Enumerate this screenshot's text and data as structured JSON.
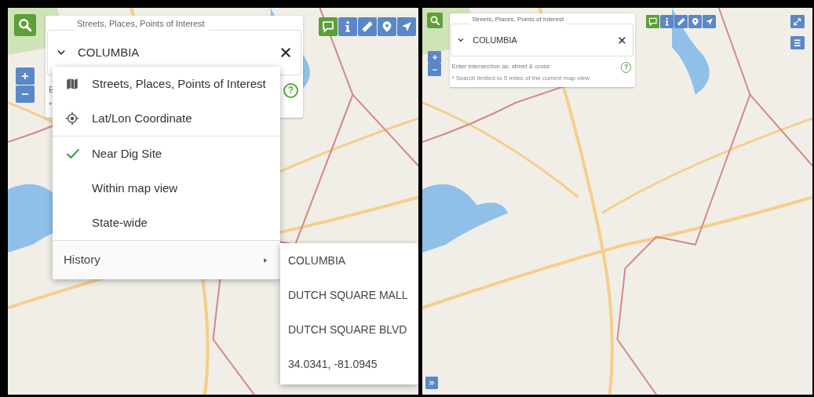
{
  "panels": [
    {
      "search": {
        "legend": "Streets, Places, Points of Interest",
        "value": "COLUMBIA",
        "hint": "E",
        "note": "*",
        "help": "?"
      },
      "tools": [
        {
          "kind": "comment",
          "active": true
        },
        {
          "kind": "info",
          "active": false
        },
        {
          "kind": "ruler",
          "active": false
        },
        {
          "kind": "pin",
          "active": false
        },
        {
          "kind": "navigate",
          "active": false
        }
      ],
      "menu": {
        "sources": [
          {
            "kind": "map",
            "label": "Streets, Places, Points of Interest"
          },
          {
            "kind": "coordinate",
            "label": "Lat/Lon Coordinate"
          }
        ],
        "scopes": [
          {
            "label": "Near Dig Site",
            "checked": true
          },
          {
            "label": "Within map view",
            "checked": false
          },
          {
            "label": "State-wide",
            "checked": false
          }
        ],
        "history": {
          "label": "History",
          "expanded": true,
          "items": [
            "COLUMBIA",
            "DUTCH SQUARE MALL",
            "DUTCH SQUARE BLVD",
            "34.0341, -81.0945"
          ]
        }
      }
    },
    {
      "search": {
        "legend": "Streets, Places, Points of Interest",
        "value": "COLUMBIA",
        "hint": "Enter intersection as: street & cross",
        "note": "* Search limited to 5 miles of the current map view",
        "help": "?"
      },
      "tools": [
        {
          "kind": "comment",
          "active": true
        },
        {
          "kind": "info",
          "active": false
        },
        {
          "kind": "ruler",
          "active": false
        },
        {
          "kind": "pin",
          "active": false
        },
        {
          "kind": "navigate",
          "active": false
        }
      ],
      "side_buttons": [
        {
          "kind": "expand"
        },
        {
          "kind": "list"
        }
      ],
      "corner_button": {
        "kind": "chevrons"
      }
    }
  ]
}
